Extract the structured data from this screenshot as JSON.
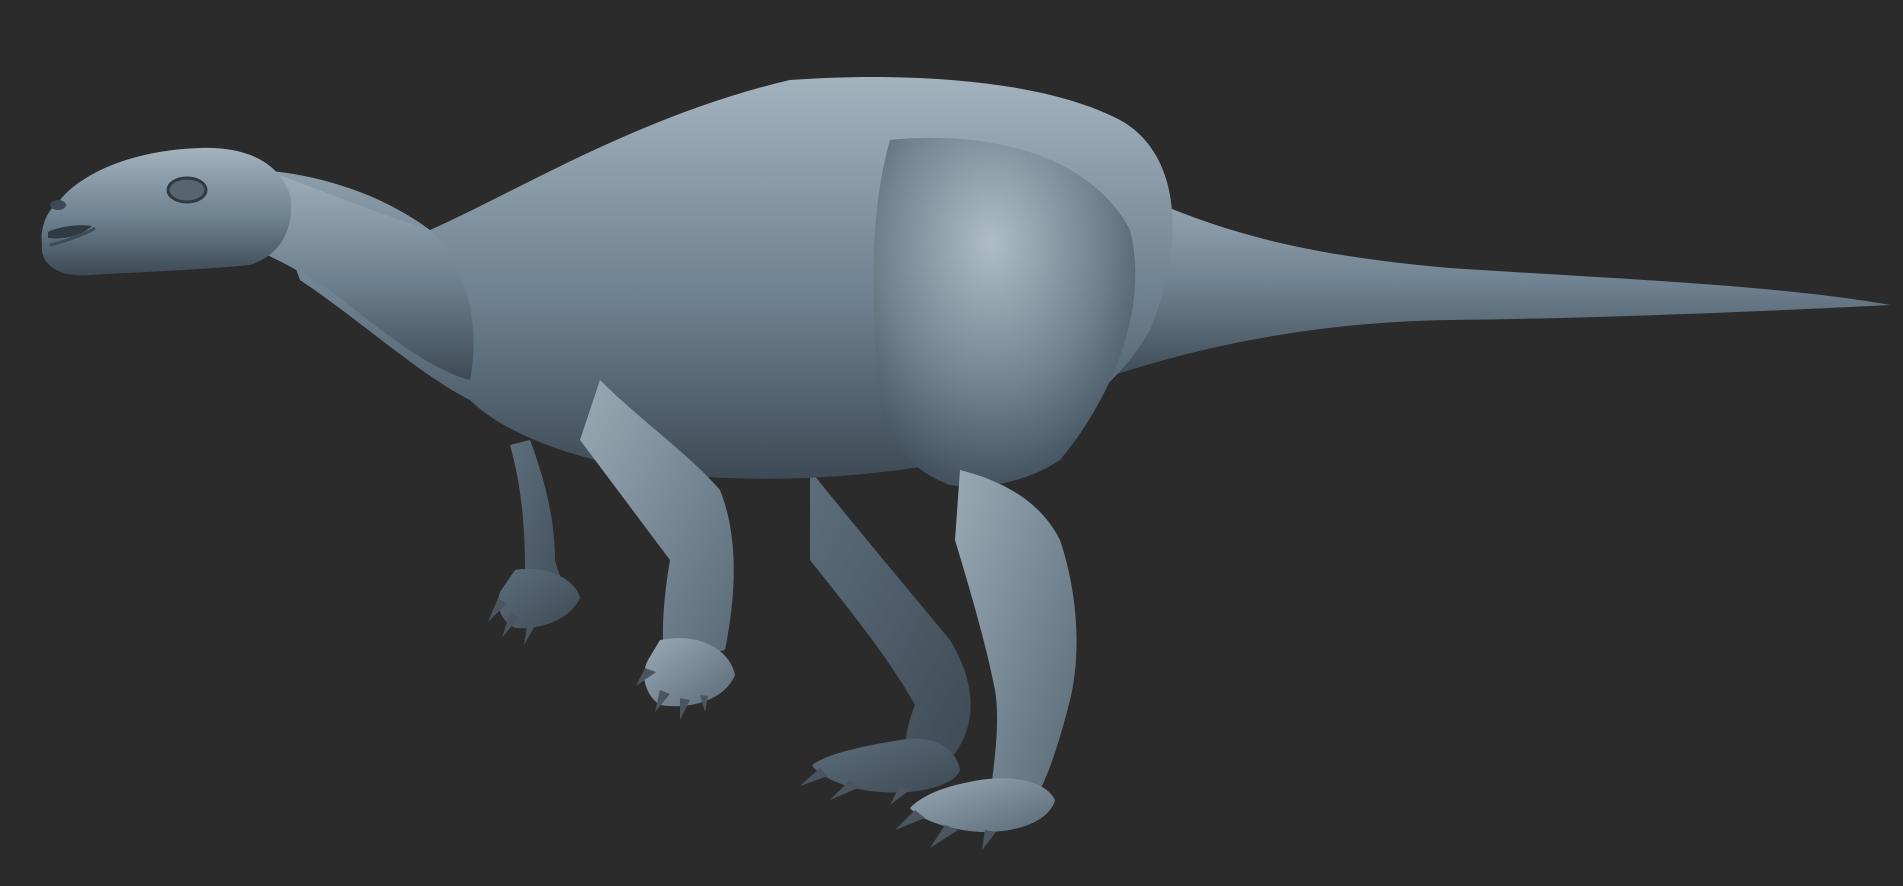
{
  "scene": {
    "subject_icon": "dinosaur-sculpt-icon",
    "colors": {
      "background": "#2b2b2b",
      "skin_base": "#6e8190",
      "skin_light": "#a3b3be",
      "skin_dark": "#3d4a55",
      "claw": "#4a5560"
    }
  }
}
